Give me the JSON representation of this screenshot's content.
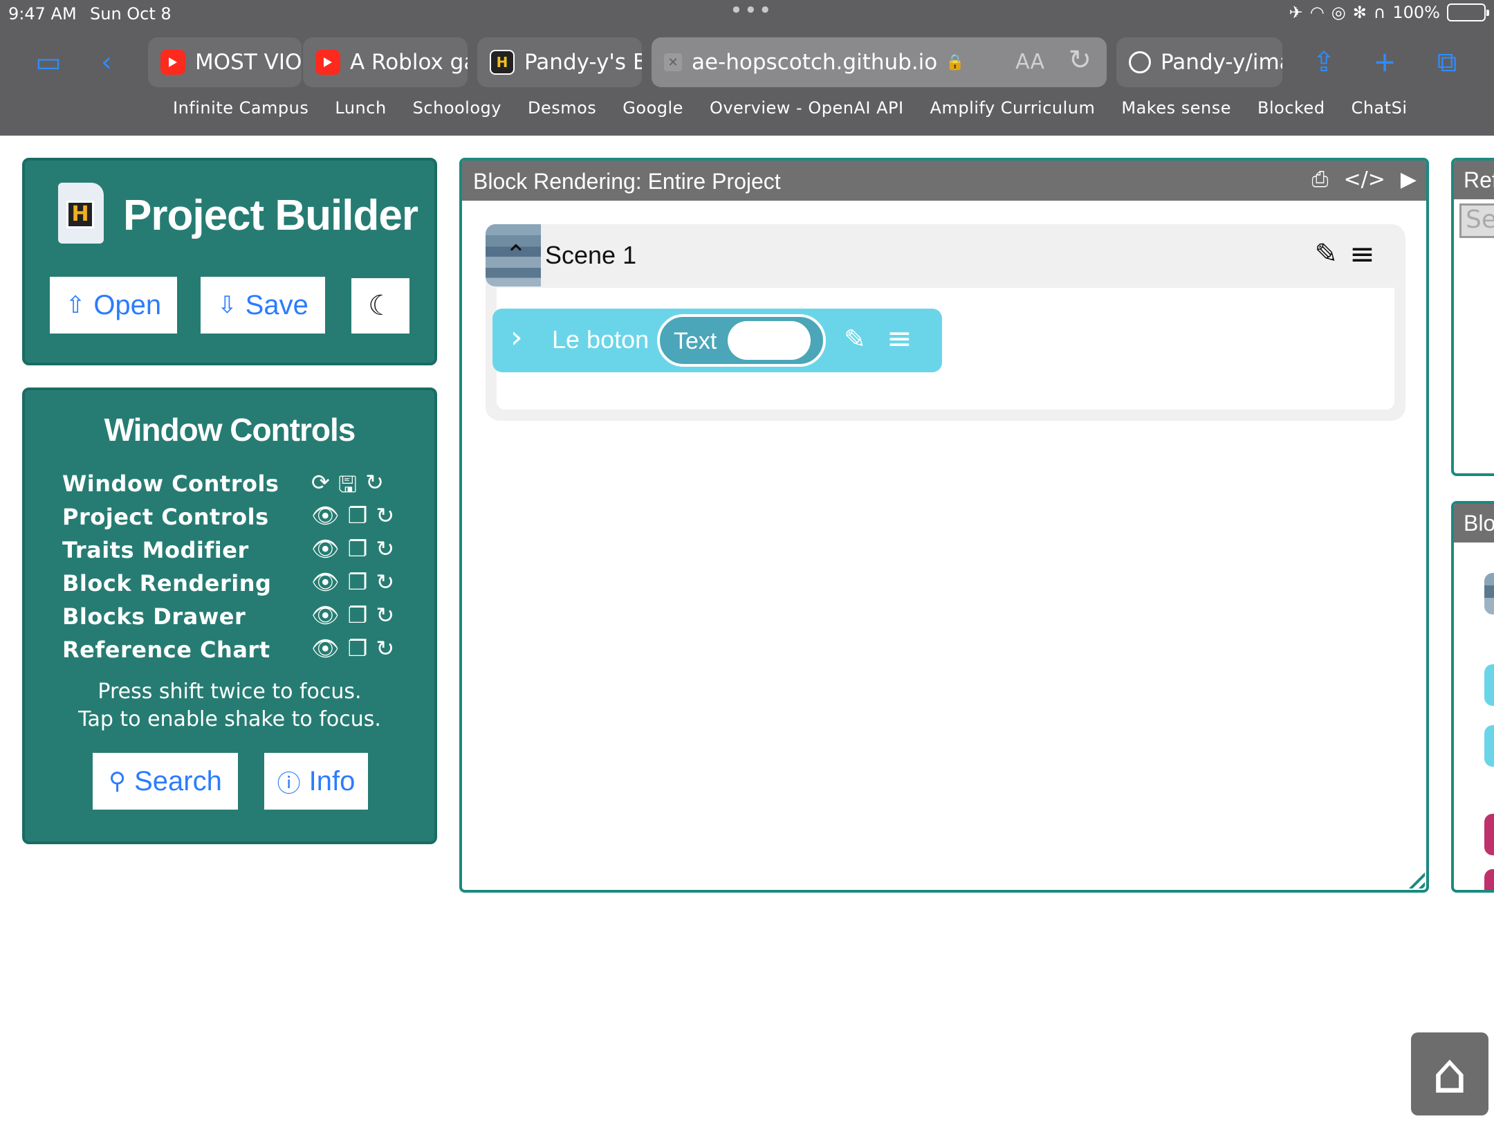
{
  "status_bar": {
    "time": "9:47 AM",
    "date": "Sun Oct 8",
    "battery": "100%"
  },
  "tabs": [
    {
      "title": "MOST VIOL",
      "favicon": "youtube-icon"
    },
    {
      "title": "A Roblox ga",
      "favicon": "youtube-icon"
    },
    {
      "title": "Pandy-y's B",
      "favicon": "hopscotch-icon"
    },
    {
      "title": "ae-hopscotch.github.io",
      "favicon": "close-icon",
      "active": true
    },
    {
      "title": "Pandy-y/ima",
      "favicon": "github-icon"
    }
  ],
  "address": {
    "aa": "AA"
  },
  "bookmarks": [
    "Infinite Campus",
    "Lunch",
    "Schoology",
    "Desmos",
    "Google",
    "Overview - OpenAI API",
    "Amplify Curriculum",
    "Makes sense",
    "Blocked",
    "ChatSi"
  ],
  "builder": {
    "logo_letter": "H",
    "title": "Project Builder",
    "open_label": "Open",
    "save_label": "Save"
  },
  "window_controls": {
    "title": "Window Controls",
    "rows": [
      {
        "label": "Window Controls"
      },
      {
        "label": "Project Controls"
      },
      {
        "label": "Traits Modifier"
      },
      {
        "label": "Block Rendering"
      },
      {
        "label": "Blocks Drawer"
      },
      {
        "label": "Reference Chart"
      }
    ],
    "hint_line1": "Press shift twice to focus.",
    "hint_line2": "Tap to enable shake to focus.",
    "search_label": "Search",
    "info_label": "Info"
  },
  "render": {
    "title": "Block Rendering: Entire Project",
    "scene_name": "Scene 1",
    "block_label": "Le boton",
    "block_param": "Text"
  },
  "side": {
    "ref_title": "Ref",
    "ref_search": "Se",
    "blocks_title": "Blo"
  },
  "colors": {
    "panel": "#267c72",
    "accent": "#2a7cff",
    "block": "#6ad5e9",
    "chrome": "#5f5f61"
  }
}
